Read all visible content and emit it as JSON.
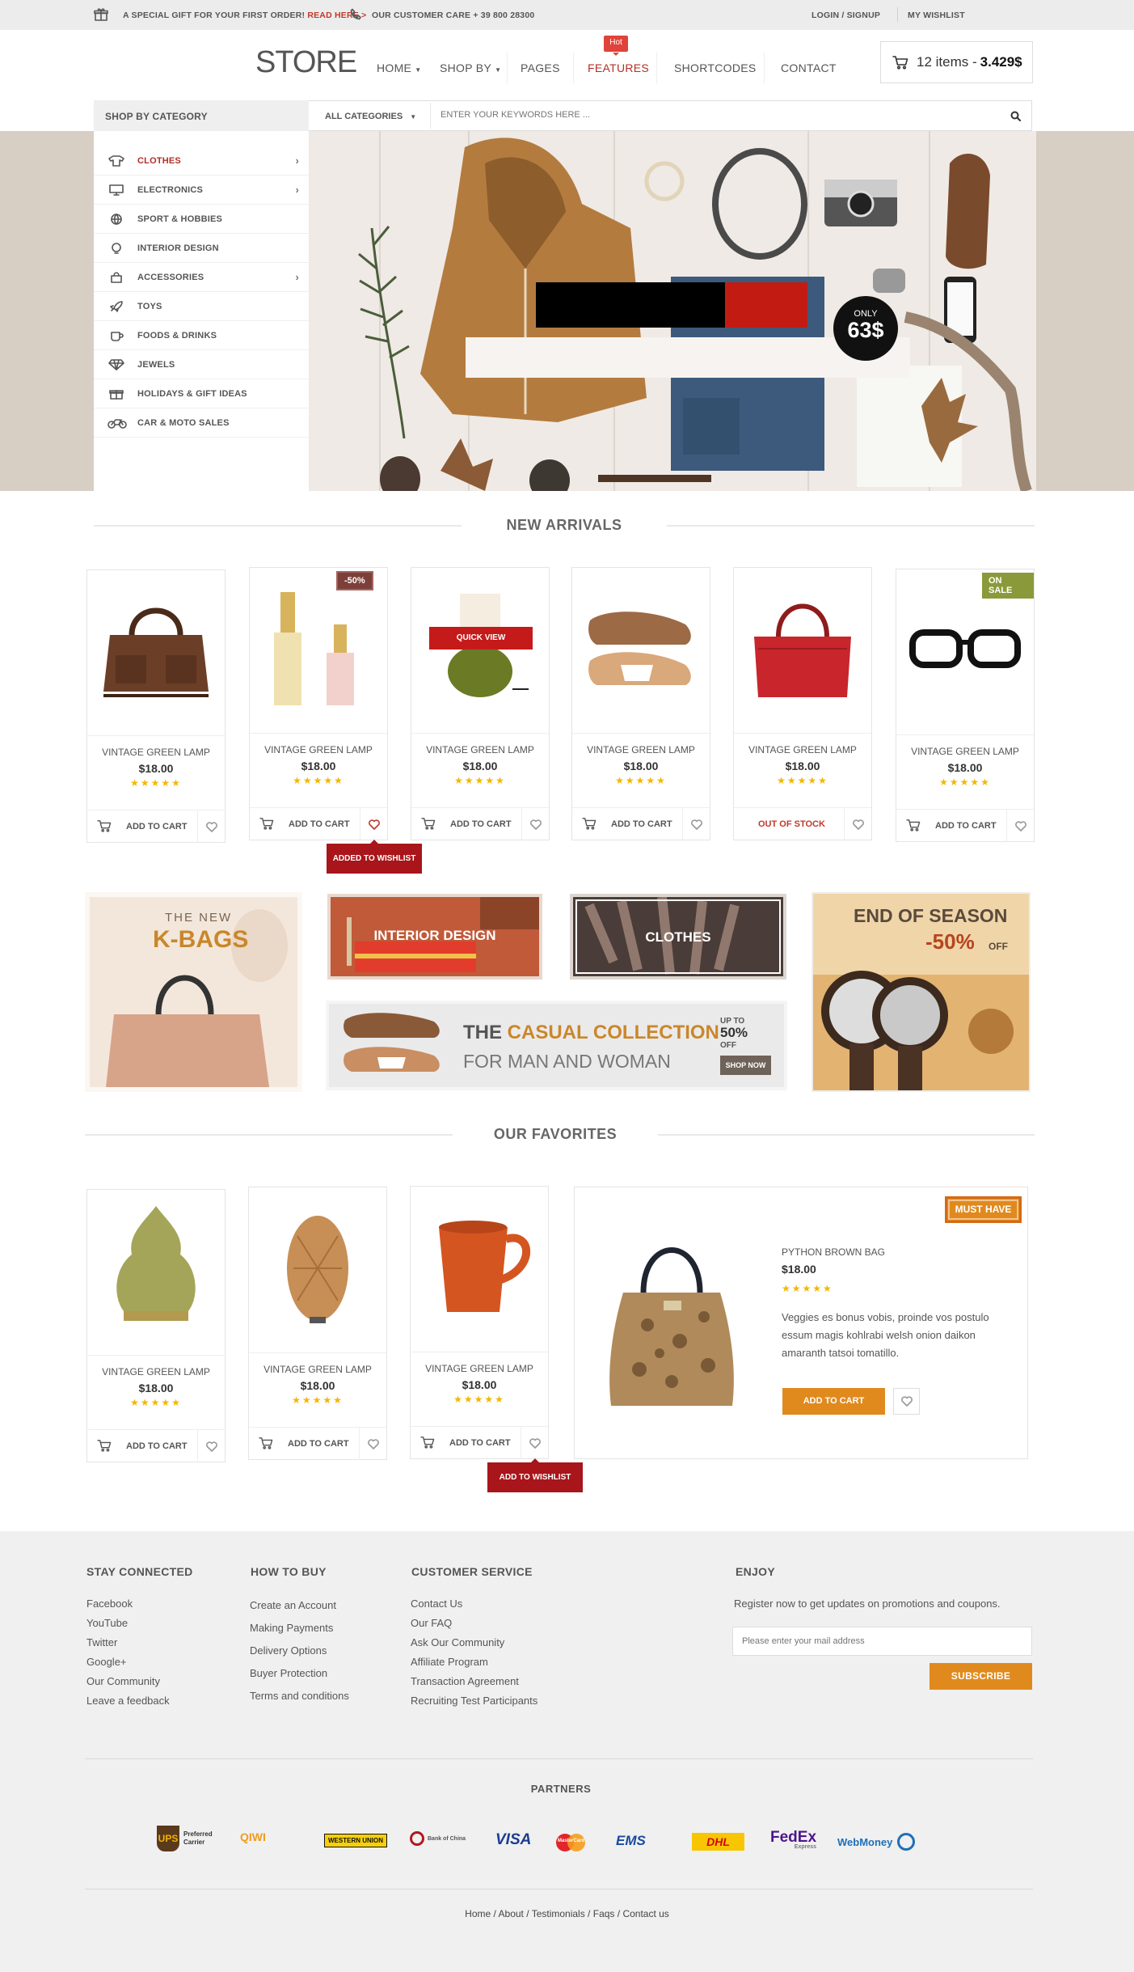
{
  "topbar": {
    "gift_text": "A SPECIAL GIFT FOR YOUR FIRST ORDER!",
    "gift_link": "READ HERE >",
    "care_text": "OUR CUSTOMER CARE + 39 800 28300",
    "login": "LOGIN / SIGNUP",
    "wishlist": "MY WISHLIST"
  },
  "header": {
    "logo": "STORE",
    "nav": [
      "HOME",
      "SHOP BY",
      "PAGES",
      "FEATURES",
      "SHORTCODES",
      "CONTACT"
    ],
    "hot_badge": "Hot",
    "cart_count": "12 items -",
    "cart_total": "3.429$"
  },
  "search": {
    "category_heading": "SHOP BY CATEGORY",
    "all_categories": "ALL CATEGORIES",
    "placeholder": "ENTER YOUR KEYWORDS HERE ..."
  },
  "categories": [
    {
      "label": "CLOTHES",
      "icon": "shirt-icon",
      "active": true,
      "has_sub": true
    },
    {
      "label": "ELECTRONICS",
      "icon": "monitor-icon",
      "has_sub": true
    },
    {
      "label": "SPORT & HOBBIES",
      "icon": "ball-icon"
    },
    {
      "label": "INTERIOR DESIGN",
      "icon": "lamp-icon"
    },
    {
      "label": "ACCESSORIES",
      "icon": "bag-icon",
      "has_sub": true
    },
    {
      "label": "TOYS",
      "icon": "rocket-icon"
    },
    {
      "label": "FOODS & DRINKS",
      "icon": "cup-icon"
    },
    {
      "label": "JEWELS",
      "icon": "diamond-icon"
    },
    {
      "label": "HOLIDAYS & GIFT IDEAS",
      "icon": "gift-icon"
    },
    {
      "label": "CAR & MOTO SALES",
      "icon": "bike-icon"
    }
  ],
  "hero": {
    "only": "ONLY",
    "price": "63$"
  },
  "new_arrivals": {
    "title": "NEW ARRIVALS",
    "products": [
      {
        "name": "VINTAGE GREEN LAMP",
        "price": "$18.00",
        "action": "ADD TO CART",
        "rating": 5
      },
      {
        "name": "VINTAGE GREEN LAMP",
        "price": "$18.00",
        "action": "ADD TO CART",
        "badge": "-50%",
        "rating": 5,
        "wishlisted": true
      },
      {
        "name": "VINTAGE GREEN LAMP",
        "price": "$18.00",
        "action": "ADD TO CART",
        "quick_view": "QUICK VIEW",
        "rating": 5
      },
      {
        "name": "VINTAGE GREEN LAMP",
        "price": "$18.00",
        "action": "ADD TO CART",
        "rating": 5
      },
      {
        "name": "VINTAGE GREEN LAMP",
        "price": "$18.00",
        "action": "OUT OF STOCK",
        "rating": 5
      },
      {
        "name": "VINTAGE GREEN LAMP",
        "price": "$18.00",
        "action": "ADD TO CART",
        "badge": "ON SALE",
        "rating": 5
      }
    ],
    "tooltip": "ADDED TO WISHLIST"
  },
  "banners": {
    "kbags_small": "THE NEW",
    "kbags_big": "K-BAGS",
    "interior": "INTERIOR DESIGN",
    "clothes": "CLOTHES",
    "casual_the": "THE",
    "casual_word": "CASUAL COLLECTION",
    "casual_sub": "FOR MAN AND WOMAN",
    "upto": "UP TO",
    "upto_pct": "50%",
    "upto_off": "OFF",
    "shop_now": "SHOP NOW",
    "eos_line1": "END OF SEASON",
    "eos_pct": "-50%",
    "eos_off": "OFF"
  },
  "favorites": {
    "title": "OUR FAVORITES",
    "products": [
      {
        "name": "VINTAGE GREEN LAMP",
        "price": "$18.00",
        "action": "ADD TO CART",
        "rating": 5
      },
      {
        "name": "VINTAGE GREEN LAMP",
        "price": "$18.00",
        "action": "ADD TO CART",
        "rating": 5
      },
      {
        "name": "VINTAGE GREEN LAMP",
        "price": "$18.00",
        "action": "ADD TO CART",
        "rating": 5
      }
    ],
    "tooltip": "ADD TO WISHLIST",
    "featured": {
      "badge": "MUST HAVE",
      "name": "PYTHON BROWN BAG",
      "price": "$18.00",
      "description": "Veggies es bonus vobis, proinde vos postulo essum magis kohlrabi welsh onion daikon amaranth tatsoi tomatillo.",
      "action": "ADD TO CART",
      "rating": 5
    }
  },
  "footer": {
    "stay_connected": {
      "title": "STAY CONNECTED",
      "links": [
        "Facebook",
        "YouTube",
        "Twitter",
        "Google+",
        "Our Community",
        "Leave a feedback"
      ]
    },
    "how_to_buy": {
      "title": "HOW TO BUY",
      "links": [
        "Create an Account",
        "Making Payments",
        "Delivery Options",
        "Buyer Protection",
        "Terms and conditions"
      ]
    },
    "customer_service": {
      "title": "CUSTOMER SERVICE",
      "links": [
        "Contact Us",
        "Our FAQ",
        "Ask Our Community",
        "Affiliate Program",
        "Transaction Agreement",
        "Recruiting Test Participants"
      ]
    },
    "enjoy": {
      "title": "ENJOY",
      "text": "Register now to get updates on promotions and coupons.",
      "placeholder": "Please enter your mail address",
      "button": "SUBSCRIBE"
    },
    "partners_title": "PARTNERS",
    "partners": [
      "UPS",
      "Preferred",
      "Carrier",
      "QIWI",
      "WESTERN UNION",
      "Bank of China",
      "VISA",
      "MasterCard",
      "EMS",
      "DHL",
      "FedEx",
      "Express",
      "WebMoney"
    ],
    "bottom_links": [
      "Home",
      "About",
      "Testimonials",
      "Faqs",
      "Contact us"
    ]
  },
  "colors": {
    "accent": "#c0392b",
    "orange": "#e08a1e",
    "star": "#f2b705",
    "footer_bg": "#f0f0f0"
  }
}
